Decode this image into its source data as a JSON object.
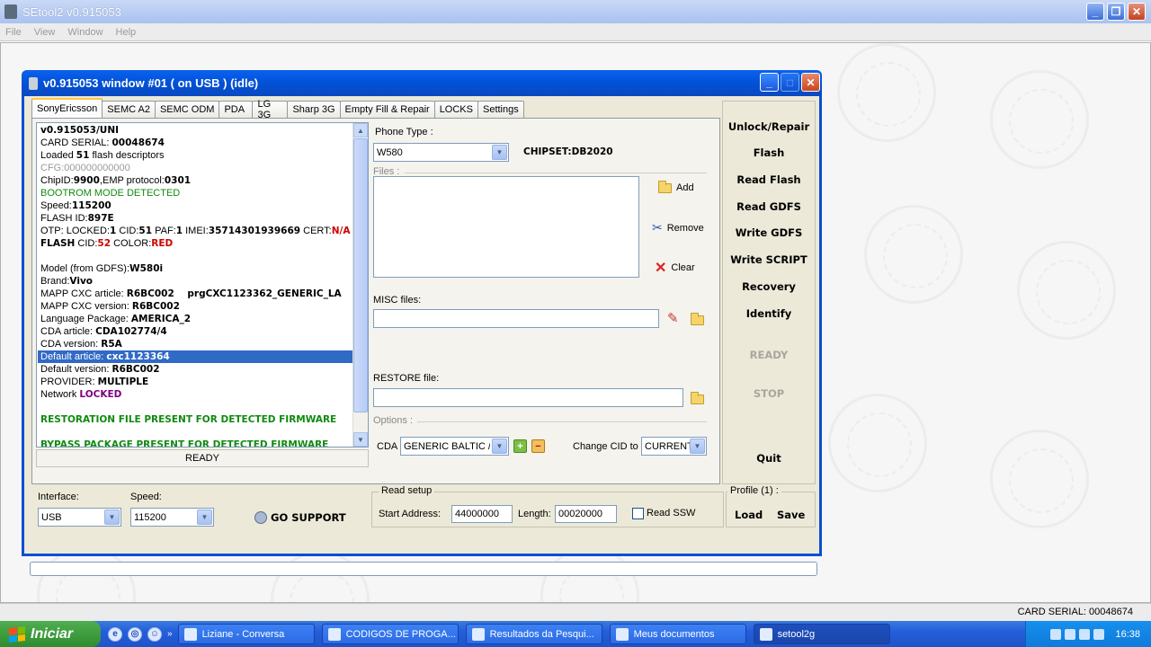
{
  "app": {
    "title": "SEtool2 v0.915053",
    "menu": [
      "File",
      "View",
      "Window",
      "Help"
    ],
    "window_buttons": {
      "minimize": "_",
      "maximize": "❐",
      "close": "✕"
    }
  },
  "child_window": {
    "title": "v0.915053 window #01 ( on USB ) (idle)"
  },
  "tabs": [
    "SonyEricsson",
    "SEMC A2",
    "SEMC ODM",
    "PDA",
    "LG 3G",
    "Sharp 3G",
    "Empty Fill & Repair",
    "LOCKS",
    "Settings"
  ],
  "log": {
    "l1": "v0.915053/UNI",
    "l2a": "CARD SERIAL: ",
    "l2b": "00048674",
    "l3a": "Loaded ",
    "l3b": "51",
    "l3c": " flash descriptors",
    "l4": "CFG:000000000000",
    "l5a": "ChipID:",
    "l5b": "9900",
    "l5c": ",EMP protocol:",
    "l5d": "0301",
    "l6": "BOOTROM MODE DETECTED",
    "l7a": "Speed:",
    "l7b": "115200",
    "l8a": "FLASH ID:",
    "l8b": "897E",
    "l9a": "OTP: LOCKED:",
    "l9b": "1",
    "l9c": " CID:",
    "l9d": "51",
    "l9e": " PAF:",
    "l9f": "1",
    "l9g": " IMEI:",
    "l9h": "35714301939669",
    "l9i": " CERT:",
    "l9j": "N/A",
    "l10a": "FLASH",
    "l10b": " CID:",
    "l10c": "52",
    "l10d": " COLOR:",
    "l10e": "RED",
    "l11a": "Model (from GDFS):",
    "l11b": "W580i",
    "l12a": "Brand:",
    "l12b": "Vivo",
    "l13a": "MAPP CXC article: ",
    "l13b": "R6BC002    prgCXC1123362_GENERIC_LA",
    "l14a": "MAPP CXC version: ",
    "l14b": "R6BC002",
    "l15a": "Language Package: ",
    "l15b": "AMERICA_2",
    "l16a": "CDA article: ",
    "l16b": "CDA102774/4",
    "l17a": "CDA version: ",
    "l17b": "R5A",
    "l18a": "Default article: ",
    "l18b": "cxc1123364",
    "l19a": "Default version: ",
    "l19b": "R6BC002",
    "l20a": "PROVIDER: ",
    "l20b": "MULTIPLE",
    "l21a": "Network ",
    "l21b": "LOCKED",
    "l22": "RESTORATION FILE PRESENT FOR DETECTED FIRMWARE",
    "l23": "BYPASS PACKAGE PRESENT FOR DETECTED FIRMWARE",
    "status": "READY"
  },
  "phone": {
    "phone_type_label": "Phone Type :",
    "phone_type_value": "W580",
    "chipset": "CHIPSET:DB2020",
    "files_label": "Files :",
    "add_label": "Add",
    "remove_label": "Remove",
    "clear_label": "Clear",
    "misc_label": "MISC files:",
    "restore_label": "RESTORE file:",
    "options_label": "Options :",
    "cda_label": "CDA",
    "cda_value": "GENERIC BALTIC /BALTIC",
    "change_cid_label": "Change CID to",
    "change_cid_value": "CURRENT"
  },
  "commands": {
    "unlock": "Unlock/Repair",
    "flash": "Flash",
    "read_flash": "Read Flash",
    "read_gdfs": "Read GDFS",
    "write_gdfs": "Write GDFS",
    "write_script": "Write SCRIPT",
    "recovery": "Recovery",
    "identify": "Identify",
    "ready": "READY",
    "stop": "STOP",
    "quit": "Quit"
  },
  "bottom": {
    "interface_label": "Interface:",
    "interface_value": "USB",
    "speed_label": "Speed:",
    "speed_value": "115200",
    "go_support": "GO SUPPORT",
    "read_setup_label": "Read setup",
    "start_address_label": "Start Address:",
    "start_address_value": "44000000",
    "length_label": "Length:",
    "length_value": "00020000",
    "read_ssw_label": "Read SSW",
    "profile_label": "Profile (1) :",
    "load_label": "Load",
    "save_label": "Save"
  },
  "statusbar": {
    "card_serial": "CARD SERIAL: 00048674"
  },
  "taskbar": {
    "start": "Iniciar",
    "items": [
      "Liziane - Conversa",
      "CODIGOS DE PROGA...",
      "Resultados da Pesqui...",
      "Meus documentos",
      "setool2g"
    ],
    "clock": "16:38"
  },
  "colors": {
    "title_blue": "#0151d6",
    "selected": "#316ac5",
    "green_text": "#108a10",
    "red_text": "#d00000"
  }
}
